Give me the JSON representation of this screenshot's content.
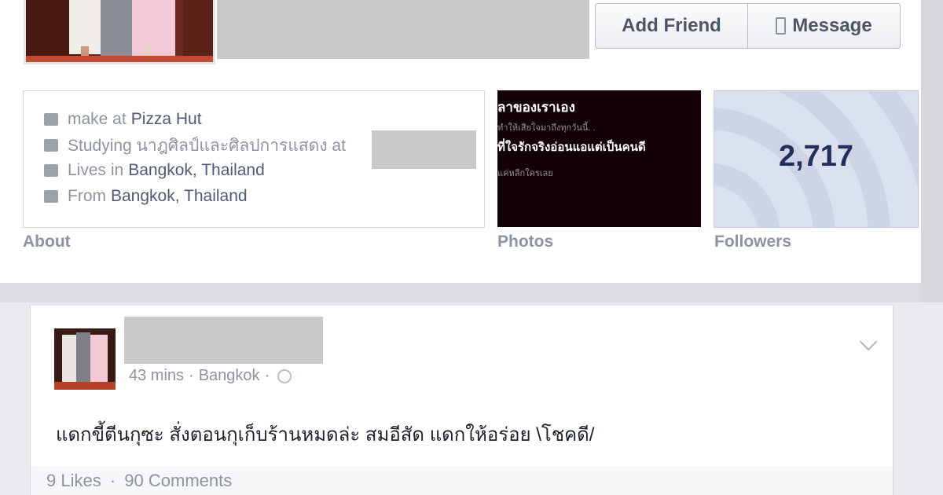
{
  "header": {
    "add_friend_label": "Add Friend",
    "message_label": "Message"
  },
  "about": {
    "label": "About",
    "items": [
      {
        "icon": "briefcase-icon",
        "prefix": "make at",
        "value": "Pizza Hut"
      },
      {
        "icon": "graduation-cap-icon",
        "prefix": "Studying นาฎศิลป์และศิลปการแสดง at",
        "value": ""
      },
      {
        "icon": "city-icon",
        "prefix": "Lives in",
        "value": "Bangkok, Thailand"
      },
      {
        "icon": "home-icon",
        "prefix": "From",
        "value": "Bangkok, Thailand"
      }
    ]
  },
  "photos": {
    "label": "Photos",
    "lines": [
      "ลาของเราเอง",
      "ทำให้เสียใจมาถึงทุกวันนี้. .",
      "ที่ใจรักจริงอ่อนแอแต่เป็นคนดี",
      "แค่หลีกใครเลย"
    ]
  },
  "followers": {
    "label": "Followers",
    "count": "2,717"
  },
  "post": {
    "time": "43 mins",
    "separator": "·",
    "location": "Bangkok",
    "text": "แดกขี้ตีนกุซะ สั่งตอนกุเก็บร้านหมดล่ะ สมอีสัด แดกให้อร่อย \\โชคดี/",
    "likes": "9 Likes",
    "comments": "90 Comments"
  }
}
